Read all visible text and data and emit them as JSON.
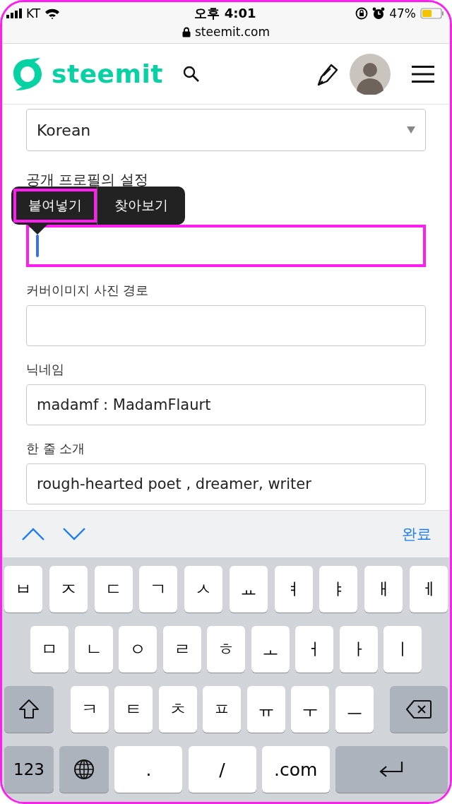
{
  "status_bar": {
    "carrier": "KT",
    "time": "오후 4:01",
    "battery": "47%"
  },
  "address_bar": {
    "url": "steemit.com"
  },
  "header": {
    "logo": "steemit"
  },
  "form": {
    "language_select": {
      "value": "Korean"
    },
    "section_title": "공개 프로필의 설정",
    "fields": [
      {
        "focused": true,
        "highlighted": true
      },
      {
        "label": "커버이미지 사진 경로",
        "focused": false,
        "highlighted": false
      },
      {
        "label": "닉네임",
        "value": "madamf : MadamFlaurt",
        "focused": false,
        "highlighted": false
      },
      {
        "label": "한 줄 소개",
        "value": "rough-hearted poet , dreamer, writer",
        "focused": false,
        "highlighted": false
      }
    ]
  },
  "context_menu": {
    "items": [
      {
        "label": "붙여넣기",
        "highlighted": true
      },
      {
        "label": "찾아보기",
        "highlighted": false
      }
    ]
  },
  "keyboard_toolbar": {
    "done": "완료"
  },
  "keyboard": {
    "rows": [
      {
        "keys": [
          {
            "kind": "letter",
            "label": "ㅂ"
          },
          {
            "kind": "letter",
            "label": "ㅈ"
          },
          {
            "kind": "letter",
            "label": "ㄷ"
          },
          {
            "kind": "letter",
            "label": "ㄱ"
          },
          {
            "kind": "letter",
            "label": "ㅅ"
          },
          {
            "kind": "letter",
            "label": "ㅛ"
          },
          {
            "kind": "letter",
            "label": "ㅕ"
          },
          {
            "kind": "letter",
            "label": "ㅑ"
          },
          {
            "kind": "letter",
            "label": "ㅐ"
          },
          {
            "kind": "letter",
            "label": "ㅔ"
          }
        ]
      },
      {
        "keys": [
          {
            "kind": "letter",
            "label": "ㅁ"
          },
          {
            "kind": "letter",
            "label": "ㄴ"
          },
          {
            "kind": "letter",
            "label": "ㅇ"
          },
          {
            "kind": "letter",
            "label": "ㄹ"
          },
          {
            "kind": "letter",
            "label": "ㅎ"
          },
          {
            "kind": "letter",
            "label": "ㅗ"
          },
          {
            "kind": "letter",
            "label": "ㅓ"
          },
          {
            "kind": "letter",
            "label": "ㅏ"
          },
          {
            "kind": "letter",
            "label": "ㅣ"
          }
        ]
      },
      {
        "keys": [
          {
            "kind": "shift"
          },
          {
            "kind": "letter",
            "label": "ㅋ"
          },
          {
            "kind": "letter",
            "label": "ㅌ"
          },
          {
            "kind": "letter",
            "label": "ㅊ"
          },
          {
            "kind": "letter",
            "label": "ㅍ"
          },
          {
            "kind": "letter",
            "label": "ㅠ"
          },
          {
            "kind": "letter",
            "label": "ㅜ"
          },
          {
            "kind": "letter",
            "label": "ㅡ"
          },
          {
            "kind": "backspace"
          }
        ]
      },
      {
        "keys": [
          {
            "kind": "numbers",
            "label": "123"
          },
          {
            "kind": "globe"
          },
          {
            "kind": "symbol",
            "label": "."
          },
          {
            "kind": "symbol",
            "label": "/"
          },
          {
            "kind": "symbol",
            "label": ".com"
          },
          {
            "kind": "return"
          }
        ]
      }
    ]
  }
}
